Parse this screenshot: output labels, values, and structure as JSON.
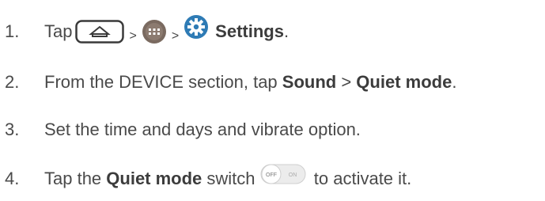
{
  "steps": [
    {
      "number": "1.",
      "parts": {
        "tap": "Tap",
        "sep1": ">",
        "sep2": ">",
        "settings": "Settings",
        "period": "."
      },
      "icons": [
        "home-key-icon",
        "apps-icon",
        "settings-gear-icon"
      ]
    },
    {
      "number": "2.",
      "parts": {
        "pre": "From the DEVICE section, tap ",
        "sound": "Sound",
        "sep": " > ",
        "quiet": "Quiet mode",
        "period": "."
      }
    },
    {
      "number": "3.",
      "text": "Set the time and days and vibrate option."
    },
    {
      "number": "4.",
      "parts": {
        "pre": "Tap the ",
        "quiet": "Quiet mode",
        "mid": " switch ",
        "post": " to activate it."
      },
      "switch": {
        "off": "OFF",
        "on": "ON"
      }
    }
  ],
  "colors": {
    "text": "#4a4a4a",
    "apps_icon": "#7a6a60",
    "settings_icon": "#2e7bb5",
    "switch_off": "#e8e8e8"
  }
}
